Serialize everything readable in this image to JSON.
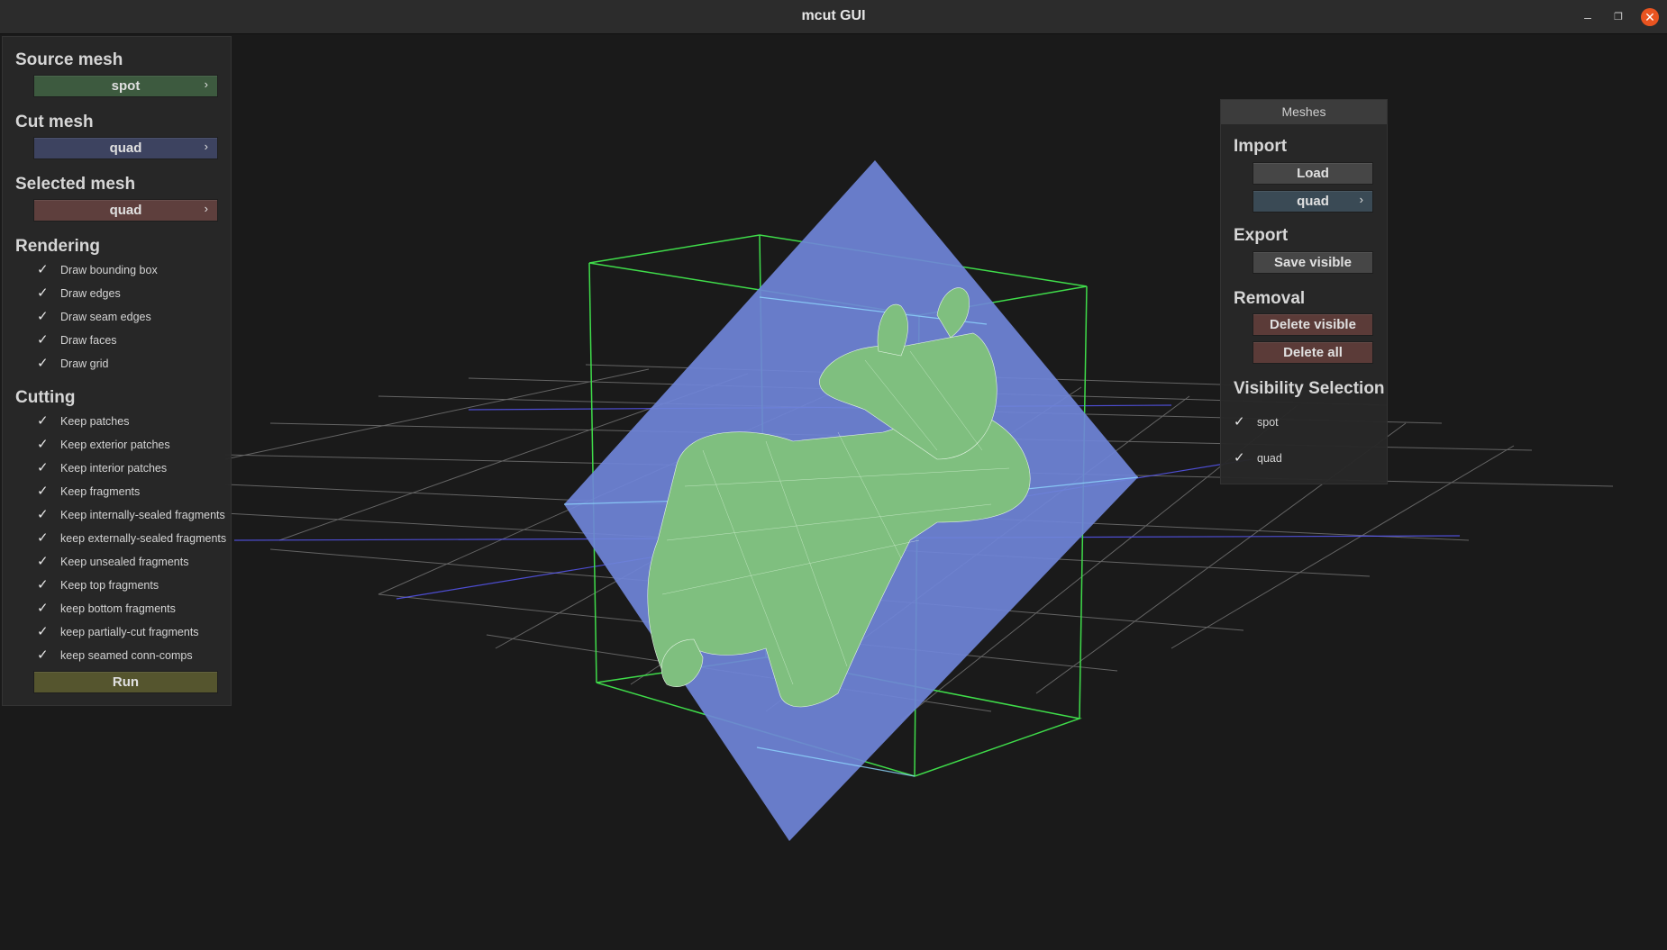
{
  "window": {
    "title": "mcut GUI",
    "minimize": "–",
    "maximize": "❐",
    "close": "✕"
  },
  "left_panel": {
    "source_mesh": {
      "title": "Source mesh",
      "value": "spot",
      "color": "#3d5a3f"
    },
    "cut_mesh": {
      "title": "Cut mesh",
      "value": "quad",
      "color": "#3d4360"
    },
    "selected_mesh": {
      "title": "Selected mesh",
      "value": "quad",
      "color": "#5e3f3d"
    },
    "rendering": {
      "title": "Rendering",
      "options": [
        {
          "label": "Draw bounding box",
          "checked": true
        },
        {
          "label": "Draw edges",
          "checked": true
        },
        {
          "label": "Draw seam edges",
          "checked": true
        },
        {
          "label": "Draw faces",
          "checked": true
        },
        {
          "label": "Draw grid",
          "checked": true
        }
      ]
    },
    "cutting": {
      "title": "Cutting",
      "options": [
        {
          "label": "Keep patches",
          "checked": true
        },
        {
          "label": "Keep exterior patches",
          "checked": true
        },
        {
          "label": "Keep interior patches",
          "checked": true
        },
        {
          "label": "Keep fragments",
          "checked": true
        },
        {
          "label": "Keep internally-sealed fragments",
          "checked": true
        },
        {
          "label": "keep externally-sealed fragments",
          "checked": true
        },
        {
          "label": "Keep unsealed fragments",
          "checked": true
        },
        {
          "label": "Keep top fragments",
          "checked": true
        },
        {
          "label": "keep bottom fragments",
          "checked": true
        },
        {
          "label": "keep partially-cut fragments",
          "checked": true
        },
        {
          "label": "keep seamed conn-comps",
          "checked": true
        }
      ],
      "run_label": "Run",
      "run_color": "#55552e"
    }
  },
  "meshes_panel": {
    "header": "Meshes",
    "import": {
      "title": "Import",
      "load_label": "Load",
      "mesh_value": "quad",
      "mesh_color": "#3a4a55"
    },
    "export": {
      "title": "Export",
      "save_label": "Save visible"
    },
    "removal": {
      "title": "Removal",
      "delete_visible_label": "Delete visible",
      "delete_all_label": "Delete all",
      "danger_color": "#5b3b38"
    },
    "visibility": {
      "title": "Visibility Selection",
      "items": [
        {
          "label": "spot",
          "checked": true
        },
        {
          "label": "quad",
          "checked": true
        }
      ]
    }
  },
  "icons": {
    "check": "✓",
    "arrow": "›"
  },
  "scene": {
    "cut_plane_color": "#6f84d8",
    "mesh_color": "#7fbf7f",
    "bbox_color": "#3fdc4a",
    "grid_color": "#8a8a8a",
    "grid_axis_color": "#5a5aff"
  }
}
